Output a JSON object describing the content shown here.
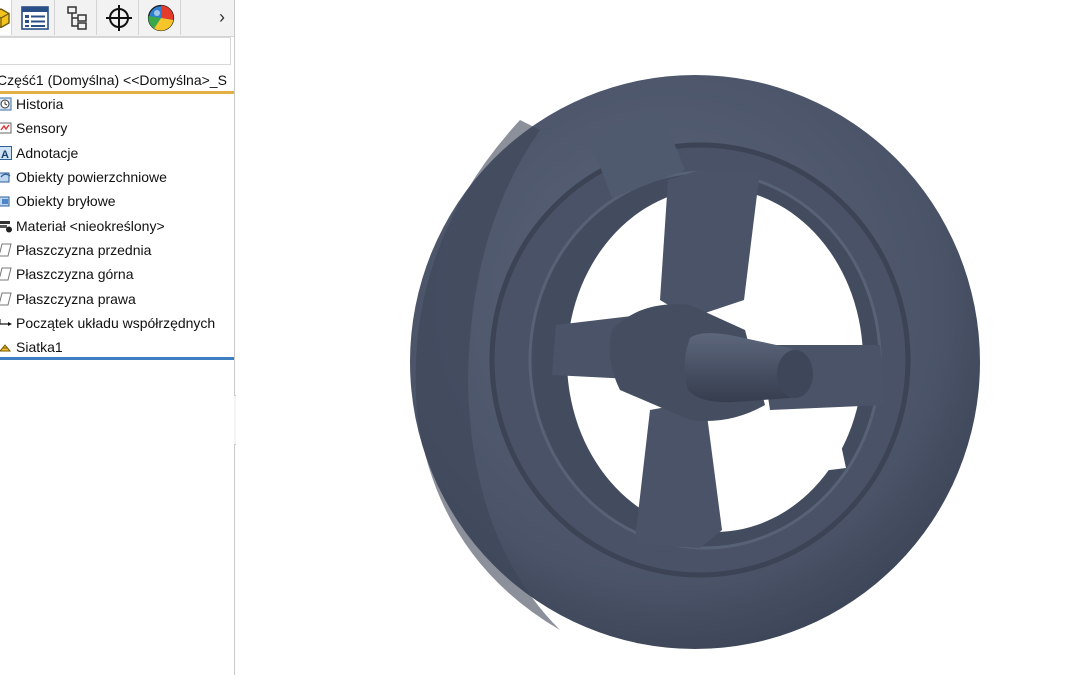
{
  "feature_tree": {
    "root_label": "Część1 (Domyślna) <<Domyślna>_S",
    "items": [
      {
        "label": "Historia",
        "icon": "history-icon"
      },
      {
        "label": "Sensory",
        "icon": "sensor-icon"
      },
      {
        "label": "Adnotacje",
        "icon": "annotations-icon"
      },
      {
        "label": "Obiekty powierzchniowe",
        "icon": "surface-bodies-icon"
      },
      {
        "label": "Obiekty bryłowe",
        "icon": "solid-bodies-icon"
      },
      {
        "label": "Materiał <nieokreślony>",
        "icon": "material-icon"
      },
      {
        "label": "Płaszczyzna przednia",
        "icon": "plane-icon"
      },
      {
        "label": "Płaszczyzna górna",
        "icon": "plane-icon"
      },
      {
        "label": "Płaszczyzna prawa",
        "icon": "plane-icon"
      },
      {
        "label": "Początek układu współrzędnych",
        "icon": "origin-icon"
      },
      {
        "label": "Siatka1",
        "icon": "mesh-icon"
      }
    ]
  },
  "tabs": [
    {
      "name": "feature-manager-tab",
      "icon": "part-icon"
    },
    {
      "name": "property-manager-tab",
      "icon": "property-list-icon"
    },
    {
      "name": "configuration-manager-tab",
      "icon": "configuration-icon"
    },
    {
      "name": "dimxpert-manager-tab",
      "icon": "crosshair-icon"
    },
    {
      "name": "display-manager-tab",
      "icon": "appearance-sphere-icon"
    }
  ],
  "colors": {
    "model": "#4b5468",
    "root_underline": "#e2b043",
    "rollback_bar": "#3d7fc1"
  }
}
